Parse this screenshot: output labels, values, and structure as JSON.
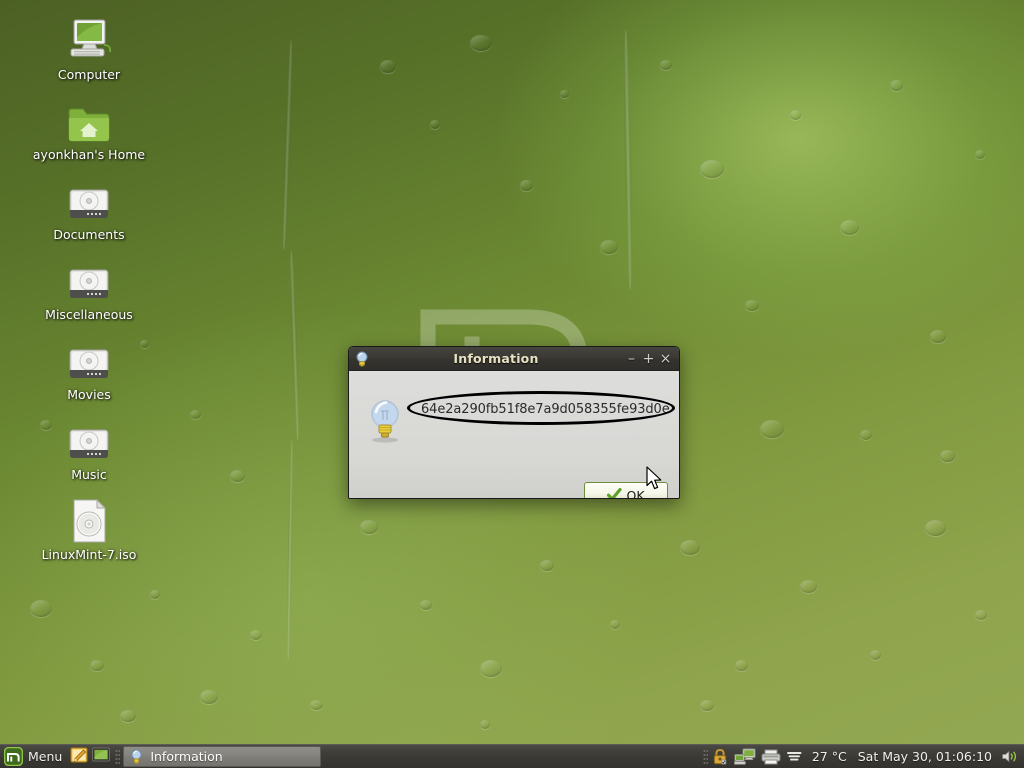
{
  "desktop": {
    "icons": [
      {
        "label": "Computer",
        "icon": "computer-icon"
      },
      {
        "label": "ayonkhan's Home",
        "icon": "home-folder-icon"
      },
      {
        "label": "Documents",
        "icon": "harddisk-icon"
      },
      {
        "label": "Miscellaneous",
        "icon": "harddisk-icon"
      },
      {
        "label": "Movies",
        "icon": "harddisk-icon"
      },
      {
        "label": "Music",
        "icon": "harddisk-icon"
      },
      {
        "label": "LinuxMint-7.iso",
        "icon": "iso-disc-icon"
      }
    ],
    "wallpaper_logo": "linux-mint-logo-watermark"
  },
  "dialog": {
    "title": "Information",
    "icon": "lightbulb-icon",
    "message": "64e2a290fb51f8e7a9d058355fe93d0e",
    "annotation": "black-ellipse-highlight",
    "buttons": {
      "minimize": "–",
      "maximize": "+",
      "close": "×",
      "ok_label_prefix": "O",
      "ok_label_suffix": "K",
      "ok_icon": "green-check-icon"
    }
  },
  "taskbar": {
    "menu_label": "Menu",
    "launchers": [
      {
        "name": "text-editor-icon"
      },
      {
        "name": "show-desktop-icon"
      }
    ],
    "windows": [
      {
        "label": "Information",
        "icon": "lightbulb-icon",
        "active": true
      }
    ],
    "tray": [
      {
        "name": "lock-icon"
      },
      {
        "name": "network-icon"
      },
      {
        "name": "printer-icon"
      },
      {
        "name": "weather-icon"
      }
    ],
    "temperature": "27 °C",
    "clock": "Sat May 30, 01:06:10",
    "volume_icon": "volume-icon"
  },
  "colors": {
    "desktop_green": "#6d8a33",
    "titlebar_dark": "#3a3934",
    "title_text": "#e8e2c4",
    "dialog_bg": "#d6d6d3",
    "button_border_green": "#6e8d3a",
    "check_green": "#5fa12a",
    "mint_green": "#8ab82f"
  }
}
